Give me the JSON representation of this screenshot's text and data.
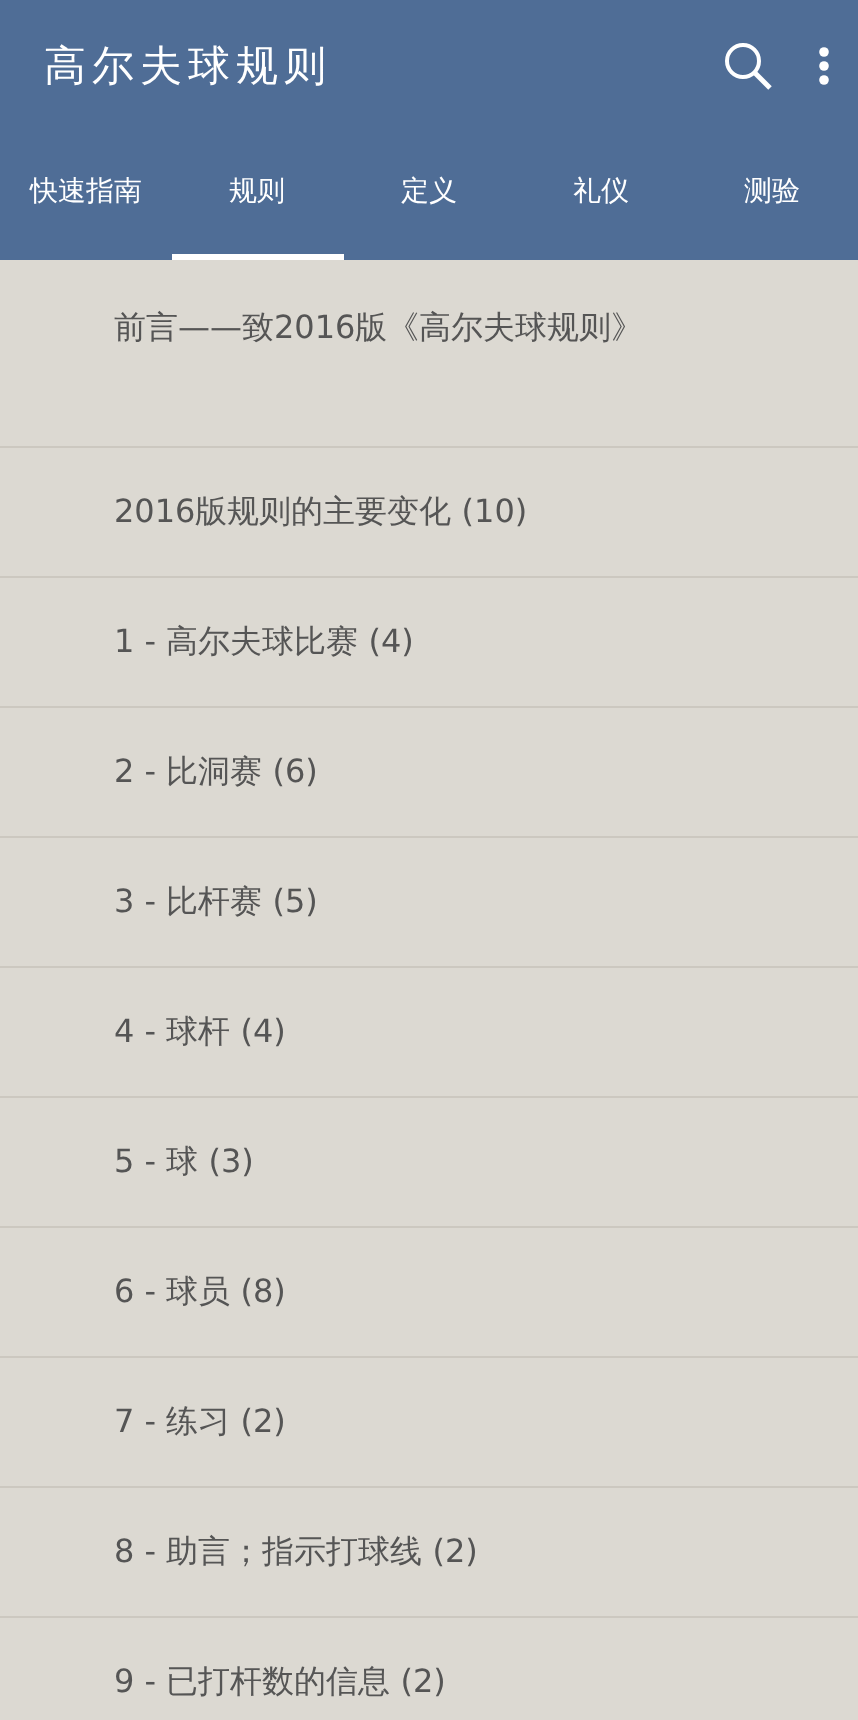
{
  "app_bar": {
    "title": "高尔夫球规则"
  },
  "tabs": [
    {
      "label": "快速指南",
      "selected": false
    },
    {
      "label": "规则",
      "selected": true
    },
    {
      "label": "定义",
      "selected": false
    },
    {
      "label": "礼仪",
      "selected": false
    },
    {
      "label": "测验",
      "selected": false
    }
  ],
  "list": [
    {
      "label": "前言——致2016版《高尔夫球规则》"
    },
    {
      "label": "2016版规则的主要变化 (10)"
    },
    {
      "label": "1 - 高尔夫球比赛 (4)"
    },
    {
      "label": "2 - 比洞赛 (6)"
    },
    {
      "label": "3 - 比杆赛 (5)"
    },
    {
      "label": "4 - 球杆 (4)"
    },
    {
      "label": "5 - 球 (3)"
    },
    {
      "label": "6 - 球员 (8)"
    },
    {
      "label": "7 - 练习 (2)"
    },
    {
      "label": "8 - 助言；指示打球线 (2)"
    },
    {
      "label": "9 - 已打杆数的信息 (2)"
    }
  ]
}
